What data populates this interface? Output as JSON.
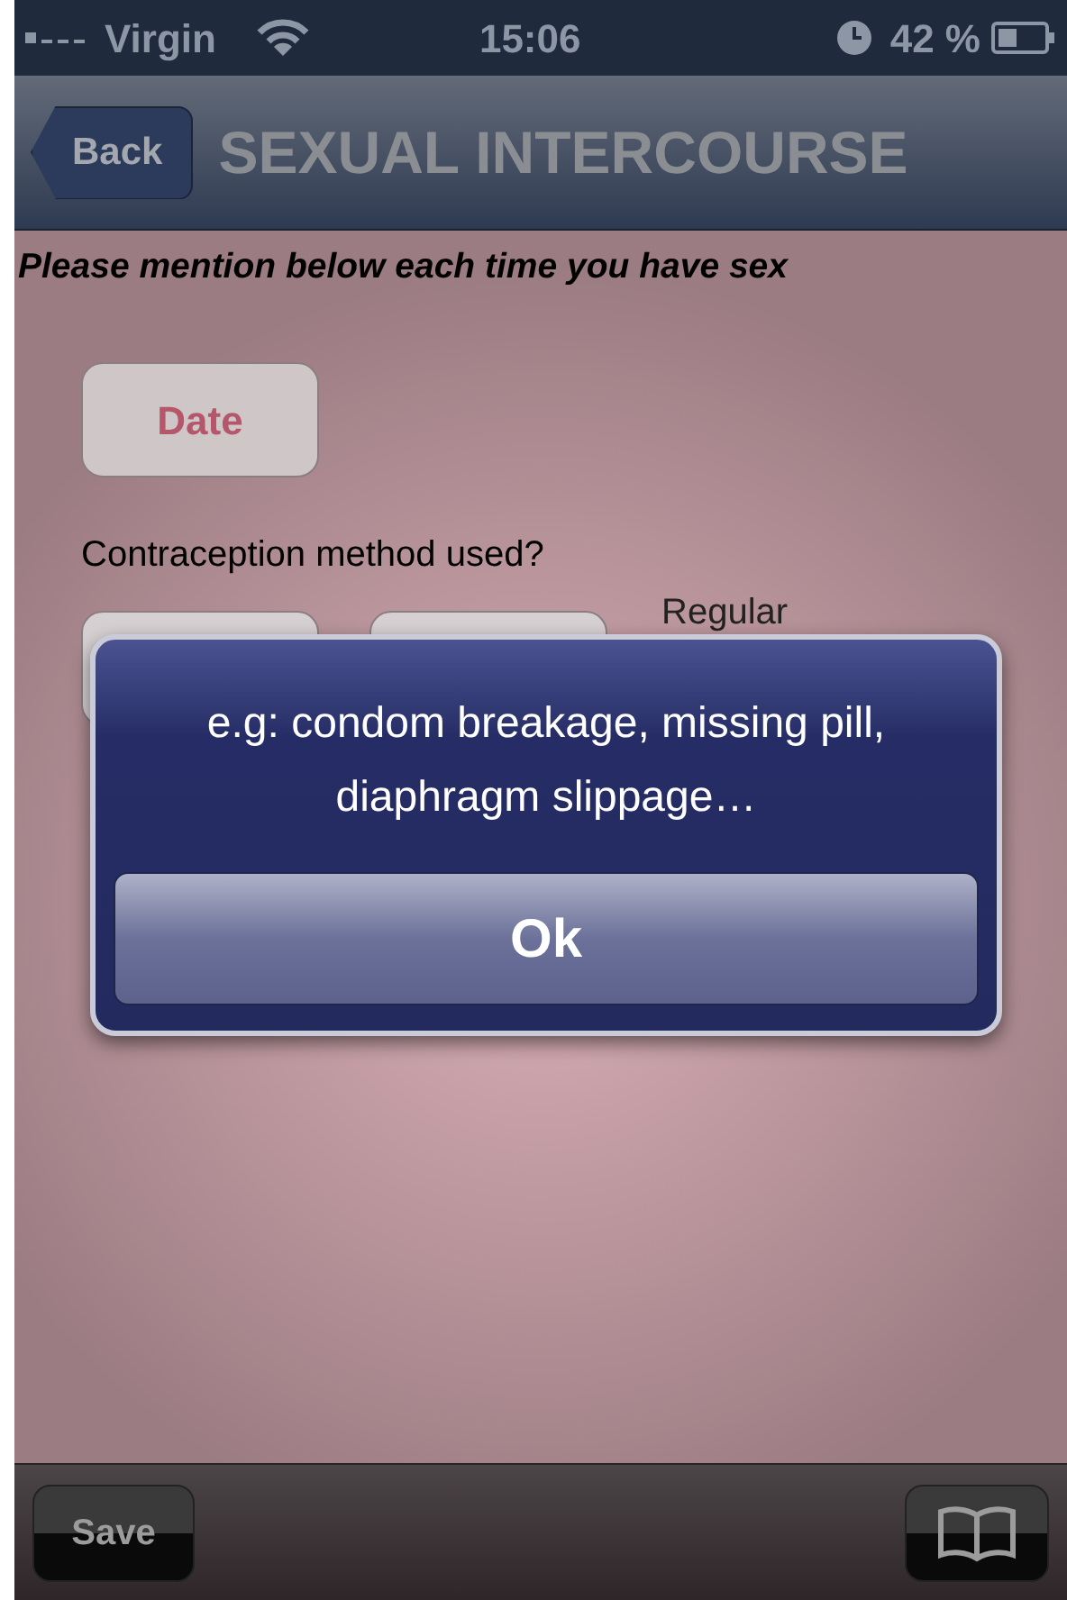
{
  "status_bar": {
    "carrier": "Virgin",
    "time": "15:06",
    "battery": "42 %"
  },
  "nav": {
    "back": "Back",
    "title": "SEXUAL INTERCOURSE"
  },
  "instruction": "Please mention below each time you have sex",
  "date_button": "Date",
  "question_1": "Contraception method used?",
  "method_label": "Regular",
  "alert": {
    "message": "e.g: condom breakage, missing pill, diaphragm slippage…",
    "button": "Ok"
  },
  "toolbar": {
    "save": "Save"
  }
}
